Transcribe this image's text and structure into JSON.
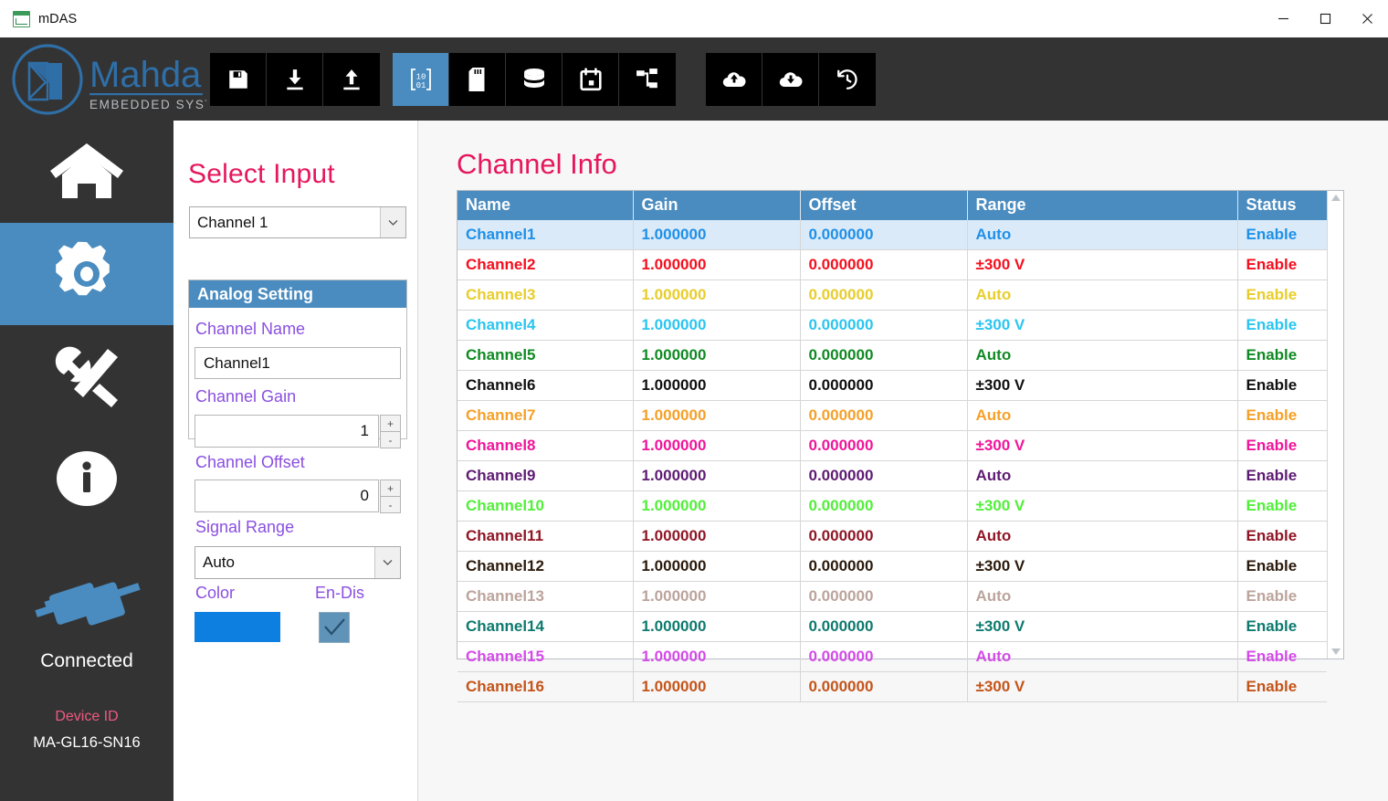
{
  "window": {
    "title": "mDAS",
    "app_icon": "mdas-app-icon",
    "minimize": "minimize-icon",
    "maximize": "maximize-icon",
    "close": "close-icon"
  },
  "brand": {
    "name": "Mahda",
    "tagline": "EMBEDDED SYSTEMS"
  },
  "toolbar": {
    "groups": [
      {
        "buttons": [
          {
            "name": "save-button",
            "icon": "floppy-save-icon",
            "active": false
          },
          {
            "name": "download-button",
            "icon": "download-icon",
            "active": false
          },
          {
            "name": "upload-button",
            "icon": "upload-icon",
            "active": false
          }
        ]
      },
      {
        "buttons": [
          {
            "name": "binary-data-button",
            "icon": "binary-brackets-icon",
            "active": true
          },
          {
            "name": "sdcard-button",
            "icon": "sd-card-icon",
            "active": false
          },
          {
            "name": "database-button",
            "icon": "database-icon",
            "active": false
          },
          {
            "name": "calendar-button",
            "icon": "calendar-icon",
            "active": false
          },
          {
            "name": "network-button",
            "icon": "sitemap-icon",
            "active": false
          }
        ]
      },
      {
        "buttons": [
          {
            "name": "cloud-upload-button",
            "icon": "cloud-upload-icon",
            "active": false
          },
          {
            "name": "cloud-download-button",
            "icon": "cloud-download-icon",
            "active": false
          },
          {
            "name": "history-button",
            "icon": "history-clock-icon",
            "active": false
          }
        ]
      }
    ]
  },
  "sidebar": {
    "items": [
      {
        "name": "sidebar-item-home",
        "icon": "home-icon",
        "active": false
      },
      {
        "name": "sidebar-item-settings",
        "icon": "gear-icon",
        "active": true
      },
      {
        "name": "sidebar-item-tools",
        "icon": "tools-icon",
        "active": false
      },
      {
        "name": "sidebar-item-info",
        "icon": "info-icon",
        "active": false
      }
    ],
    "connection": {
      "icon": "plug-connected-icon",
      "status": "Connected",
      "device_id_label": "Device ID",
      "device_id_value": "MA-GL16-SN16"
    }
  },
  "settings": {
    "select_input_title": "Select Input",
    "input_combo": {
      "value": "Channel 1",
      "arrow": "chevron-down-icon"
    },
    "analog_setting_header": "Analog Setting",
    "fields": {
      "channel_name_label": "Channel Name",
      "channel_name_value": "Channel1",
      "channel_gain_label": "Channel Gain",
      "channel_gain_value": "1",
      "channel_offset_label": "Channel Offset",
      "channel_offset_value": "0",
      "signal_range_label": "Signal Range",
      "signal_range_value": "Auto",
      "color_label": "Color",
      "color_value": "#0d7fe0",
      "endis_label": "En-Dis",
      "endis_checked": true,
      "spin_up": "+",
      "spin_down": "-"
    }
  },
  "main": {
    "title": "Channel Info",
    "table": {
      "columns": [
        "Name",
        "Gain",
        "Offset",
        "Range",
        "Status"
      ],
      "rows": [
        {
          "name": "Channel1",
          "gain": "1.000000",
          "offset": "0.000000",
          "range": "Auto",
          "status": "Enable",
          "color": "#1e90e8",
          "selected": true
        },
        {
          "name": "Channel2",
          "gain": "1.000000",
          "offset": "0.000000",
          "range": "±300 V",
          "status": "Enable",
          "color": "#f50f1e",
          "selected": false
        },
        {
          "name": "Channel3",
          "gain": "1.000000",
          "offset": "0.000000",
          "range": "Auto",
          "status": "Enable",
          "color": "#e8cd2a",
          "selected": false
        },
        {
          "name": "Channel4",
          "gain": "1.000000",
          "offset": "0.000000",
          "range": "±300 V",
          "status": "Enable",
          "color": "#2ac5f0",
          "selected": false
        },
        {
          "name": "Channel5",
          "gain": "1.000000",
          "offset": "0.000000",
          "range": "Auto",
          "status": "Enable",
          "color": "#0f8a22",
          "selected": false
        },
        {
          "name": "Channel6",
          "gain": "1.000000",
          "offset": "0.000000",
          "range": "±300 V",
          "status": "Enable",
          "color": "#101010",
          "selected": false
        },
        {
          "name": "Channel7",
          "gain": "1.000000",
          "offset": "0.000000",
          "range": "Auto",
          "status": "Enable",
          "color": "#f5a028",
          "selected": false
        },
        {
          "name": "Channel8",
          "gain": "1.000000",
          "offset": "0.000000",
          "range": "±300 V",
          "status": "Enable",
          "color": "#f0159a",
          "selected": false
        },
        {
          "name": "Channel9",
          "gain": "1.000000",
          "offset": "0.000000",
          "range": "Auto",
          "status": "Enable",
          "color": "#5e1b73",
          "selected": false
        },
        {
          "name": "Channel10",
          "gain": "1.000000",
          "offset": "0.000000",
          "range": "±300 V",
          "status": "Enable",
          "color": "#52ef3a",
          "selected": false
        },
        {
          "name": "Channel11",
          "gain": "1.000000",
          "offset": "0.000000",
          "range": "Auto",
          "status": "Enable",
          "color": "#8f1625",
          "selected": false
        },
        {
          "name": "Channel12",
          "gain": "1.000000",
          "offset": "0.000000",
          "range": "±300 V",
          "status": "Enable",
          "color": "#2b1a0c",
          "selected": false
        },
        {
          "name": "Channel13",
          "gain": "1.000000",
          "offset": "0.000000",
          "range": "Auto",
          "status": "Enable",
          "color": "#bba49c",
          "selected": false
        },
        {
          "name": "Channel14",
          "gain": "1.000000",
          "offset": "0.000000",
          "range": "±300 V",
          "status": "Enable",
          "color": "#0d7a6e",
          "selected": false
        },
        {
          "name": "Channel15",
          "gain": "1.000000",
          "offset": "0.000000",
          "range": "Auto",
          "status": "Enable",
          "color": "#d44ae8",
          "selected": false
        },
        {
          "name": "Channel16",
          "gain": "1.000000",
          "offset": "0.000000",
          "range": "±300 V",
          "status": "Enable",
          "color": "#c4541a",
          "selected": false
        }
      ],
      "scrollbar": {
        "up": "scroll-up-arrow-icon",
        "down": "scroll-down-arrow-icon"
      }
    }
  },
  "colors": {
    "accent_blue": "#4a8cc0",
    "chrome_dark": "#333333",
    "title_pink": "#e6175c",
    "label_purple": "#8a4fe0"
  }
}
